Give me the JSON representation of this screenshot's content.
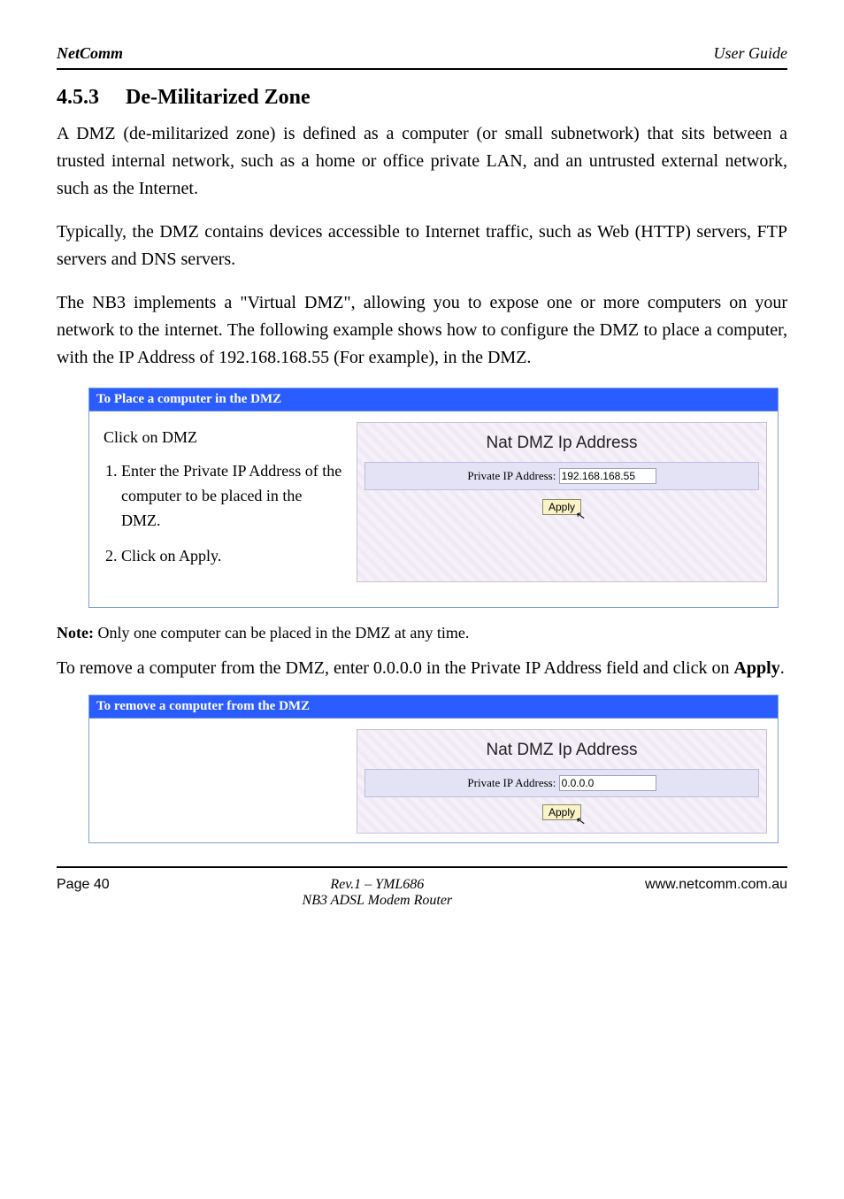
{
  "header": {
    "left": "NetComm",
    "right": "User Guide"
  },
  "section": {
    "number": "4.5.3",
    "title": "De-Militarized Zone"
  },
  "paras": {
    "p1": "A DMZ (de-militarized zone) is defined as a computer (or small subnetwork) that sits between a trusted internal network, such as a home or office private LAN, and an untrusted external network, such as the Internet.",
    "p2": "Typically, the DMZ contains devices accessible to Internet traffic, such as Web (HTTP) servers, FTP servers and DNS servers.",
    "p3": "The NB3 implements a \"Virtual DMZ\", allowing you to expose one or more computers on your network to the internet. The following example shows how to configure the DMZ to place a computer, with the IP Address of 192.168.168.55 (For example), in the DMZ."
  },
  "panel1": {
    "title": "To Place a computer in the DMZ",
    "left_intro": "Click on DMZ",
    "steps": [
      "Enter the Private IP Address of the computer to be placed in the DMZ.",
      "Click on Apply."
    ],
    "box_title": "Nat DMZ Ip Address",
    "field_label": "Private IP Address:",
    "field_value": "192.168.168.55",
    "apply_label": "Apply"
  },
  "note": {
    "label": "Note:",
    "text": "Only one computer can be placed in the DMZ at any time."
  },
  "remove_heading": "To remove a computer from the DMZ, enter 0.0.0.0 in the Private IP Address field and click on Apply.",
  "panel2": {
    "title": "To remove a computer from the DMZ",
    "box_title": "Nat DMZ Ip Address",
    "field_label": "Private IP Address:",
    "field_value": "0.0.0.0",
    "apply_label": "Apply"
  },
  "footer": {
    "left": "Page 40",
    "center": "Rev.1 – YML686",
    "right": "www.netcomm.com.au",
    "pdf": "NB3 ADSL Modem Router"
  }
}
